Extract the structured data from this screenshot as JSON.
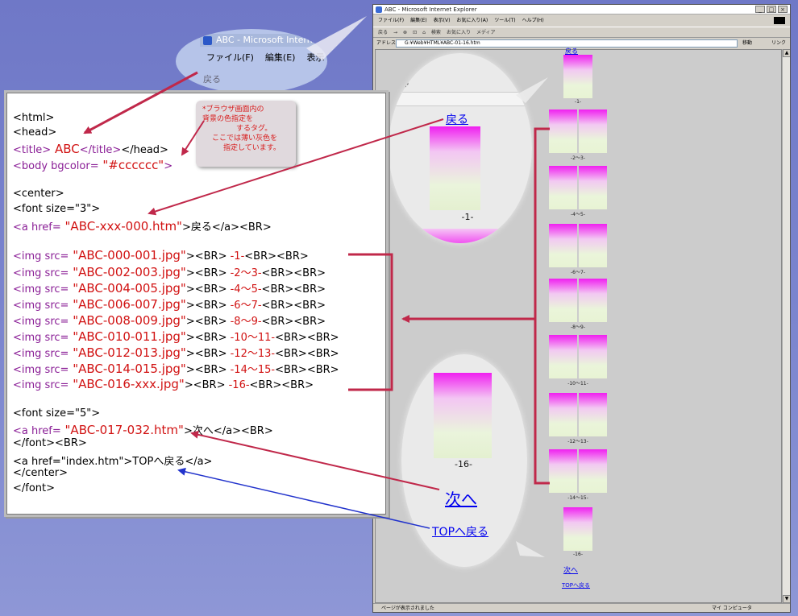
{
  "title_bubble": {
    "window_title": "ABC - Microsoft Intern",
    "menu": [
      "ファイル(F)",
      "編集(E)",
      "表示"
    ],
    "nav_back": "戻る"
  },
  "ie": {
    "window_title": "ABC - Microsoft Internet Explorer",
    "menu": [
      "ファイル(F)",
      "編集(E)",
      "表示(V)",
      "お気に入り(A)",
      "ツール(T)",
      "ヘルプ(H)"
    ],
    "toolbar": [
      "戻る",
      "→",
      "⊗",
      "⊡",
      "⌂",
      "検索",
      "お気に入り",
      "メディア"
    ],
    "address_label": "アドレス(D)",
    "address_value": "G:¥Web¥HTML¥ABC-01-16.htm",
    "go_label": "移動",
    "links_label": "リンク",
    "status_left": "ページが表示されました",
    "status_right": "マイ コンピュータ",
    "back_link": "戻る",
    "captions": [
      "-1-",
      "-2〜3-",
      "-4〜5-",
      "-6〜7-",
      "-8〜9-",
      "-10〜11-",
      "-12〜13-",
      "-14〜15-",
      "-16-"
    ],
    "next_link": "次へ",
    "top_link": "TOPへ戻る"
  },
  "note": {
    "lines": [
      "*ブラウザ画面内の",
      "背景の色指定を",
      "するタグ。",
      "ここでは薄い灰色を",
      "指定しています。"
    ]
  },
  "code": {
    "html_open": "<html>",
    "head_open": "<head>",
    "title_open": "<title>",
    "title_text": " ABC",
    "title_close": "</title>",
    "head_close": "</head>",
    "body_tag": "<body bgcolor=",
    "bgcolor": " \"#cccccc\"",
    "body_end": ">",
    "center_open": "<center>",
    "font3": "<font size=\"3\">",
    "a_open": "<a href=",
    "back_href": " \"ABC-xxx-000.htm\"",
    "back_rest": ">戻る</a><BR>",
    "img_lines": [
      {
        "src": " \"ABC-000-001.jpg\"",
        "rest": "><BR> ",
        "cap": "-1-",
        "end": "<BR><BR>"
      },
      {
        "src": " \"ABC-002-003.jpg\"",
        "rest": "><BR> ",
        "cap": "-2〜3-",
        "end": "<BR><BR>"
      },
      {
        "src": " \"ABC-004-005.jpg\"",
        "rest": "><BR> ",
        "cap": "-4〜5-",
        "end": "<BR><BR>"
      },
      {
        "src": " \"ABC-006-007.jpg\"",
        "rest": "><BR> ",
        "cap": "-6〜7-",
        "end": "<BR><BR>"
      },
      {
        "src": " \"ABC-008-009.jpg\"",
        "rest": "><BR> ",
        "cap": "-8〜9-",
        "end": "<BR><BR>"
      },
      {
        "src": " \"ABC-010-011.jpg\"",
        "rest": "><BR> ",
        "cap": "-10〜11-",
        "end": "<BR><BR>"
      },
      {
        "src": " \"ABC-012-013.jpg\"",
        "rest": "><BR> ",
        "cap": "-12〜13-",
        "end": "<BR><BR>"
      },
      {
        "src": " \"ABC-014-015.jpg\"",
        "rest": "><BR> ",
        "cap": "-14〜15-",
        "end": "<BR><BR>"
      },
      {
        "src": " \"ABC-016-xxx.jpg\"",
        "rest": "><BR> ",
        "cap": "-16-",
        "end": "<BR><BR>"
      }
    ],
    "img_open": "<img src=",
    "font5": "<font size=\"5\">",
    "next_href": " \"ABC-017-032.htm\"",
    "next_rest": ">次へ</a><BR>",
    "font_close_br": "</font><BR>",
    "top_line": "<a href=\"index.htm\">TOPへ戻る</a>",
    "center_close": "</center>",
    "font_close": "</font>"
  },
  "callouts": {
    "back": "戻る",
    "cap_1": "-1-",
    "cap_16": "-16-",
    "next": "次へ",
    "top": "TOPへ戻る"
  },
  "colors": {
    "tag": "#8a1e96",
    "value": "#d11212",
    "arrow_red": "#c0284a",
    "arrow_blue": "#2233cc",
    "page_bg": "#cccccc"
  }
}
